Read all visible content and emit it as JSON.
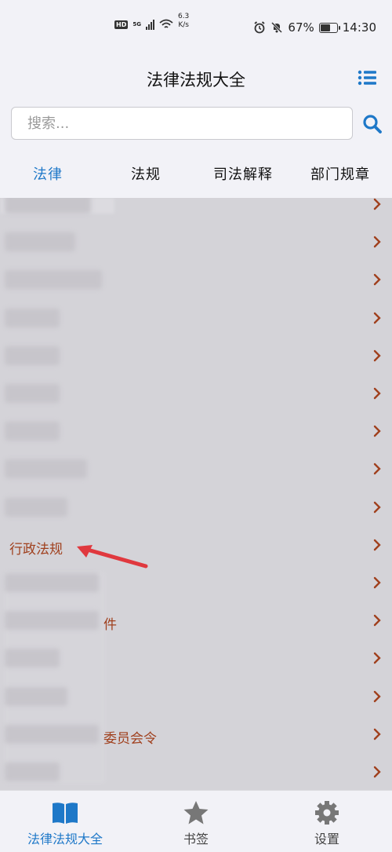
{
  "status_bar": {
    "hd": "HD",
    "signal": "5G",
    "net_speed_value": "6.3",
    "net_speed_unit": "K/s",
    "battery": "67%",
    "battery_level": 0.67,
    "time": "14:30"
  },
  "app_bar": {
    "title": "法律法规大全",
    "menu_icon": "list-menu-icon"
  },
  "search": {
    "placeholder": "搜索...",
    "value": ""
  },
  "tabs": [
    {
      "label": "法律",
      "active": true
    },
    {
      "label": "法规",
      "active": false
    },
    {
      "label": "司法解释",
      "active": false
    },
    {
      "label": "部门规章",
      "active": false
    }
  ],
  "list": {
    "items": [
      {
        "label": ""
      },
      {
        "label": ""
      },
      {
        "label": ""
      },
      {
        "label": ""
      },
      {
        "label": ""
      },
      {
        "label": ""
      },
      {
        "label": ""
      },
      {
        "label": ""
      },
      {
        "label": ""
      },
      {
        "label": "行政法规"
      },
      {
        "label": ""
      },
      {
        "label": "件"
      },
      {
        "label": ""
      },
      {
        "label": ""
      },
      {
        "label": "委员会令"
      },
      {
        "label": ""
      }
    ],
    "accent_color": "#a0401e"
  },
  "bottom_nav": [
    {
      "label": "法律法规大全",
      "icon": "book-icon",
      "active": true
    },
    {
      "label": "书签",
      "icon": "star-icon",
      "active": false
    },
    {
      "label": "设置",
      "icon": "gear-icon",
      "active": false
    }
  ],
  "colors": {
    "primary": "#1e78c8",
    "accent": "#a0401e",
    "annotation_arrow": "#e0383e"
  }
}
